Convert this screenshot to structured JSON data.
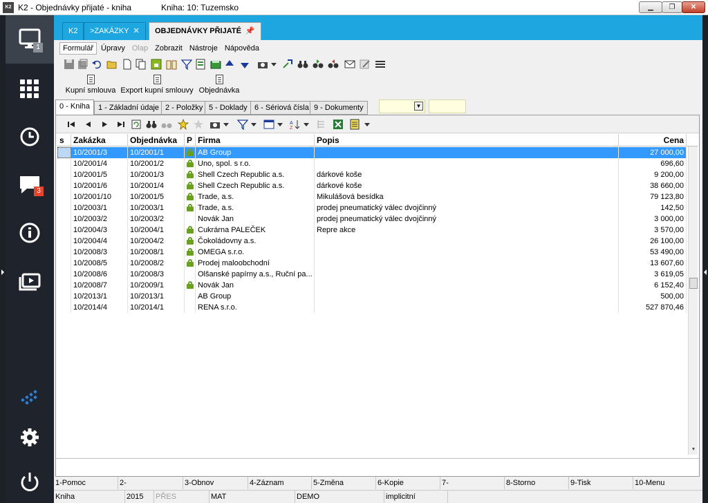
{
  "window": {
    "app_icon": "K2",
    "title": "K2 - Objednávky přijaté - kniha",
    "book": "Kniha: 10: Tuzemsko",
    "minimize": "▁",
    "restore": "❐",
    "close": "✕"
  },
  "sidenav": {
    "desktop_badge": "1",
    "messages_badge": "3",
    "icons": [
      "monitor-icon",
      "apps-grid-icon",
      "history-icon",
      "messages-icon",
      "info-icon",
      "media-icon",
      "k2-logo-icon",
      "settings-icon",
      "power-icon"
    ]
  },
  "tabs": [
    {
      "label": "K2"
    },
    {
      "label": ">ZAKÁZKY",
      "close": "✕"
    },
    {
      "label": "OBJEDNÁVKY PŘIJATÉ",
      "pin": "📌"
    }
  ],
  "menu": [
    "Formulář",
    "Úpravy",
    "Olap",
    "Zobrazit",
    "Nástroje",
    "Nápověda"
  ],
  "actions": [
    "Kupní smlouva",
    "Export kupní smlouvy",
    "Objednávka"
  ],
  "subtabs": [
    "0 - Kniha",
    "1 - Základní údaje",
    "2 - Položky",
    "5 - Doklady",
    "6 - Sériová čísla",
    "9 - Dokumenty"
  ],
  "grid": {
    "headers": {
      "s": "s",
      "zakazka": "Zakázka",
      "objednavka": "Objednávka",
      "p": "P",
      "firma": "Firma",
      "popis": "Popis",
      "cena": "Cena"
    },
    "rows": [
      {
        "zakazka": "10/2001/3",
        "objednavka": "10/2001/1",
        "locked": true,
        "firma": "AB Group",
        "popis": "",
        "cena": "27 000,00",
        "selected": true
      },
      {
        "zakazka": "10/2001/4",
        "objednavka": "10/2001/2",
        "locked": true,
        "firma": "Uno, spol. s r.o.",
        "popis": "",
        "cena": "696,60"
      },
      {
        "zakazka": "10/2001/5",
        "objednavka": "10/2001/3",
        "locked": true,
        "firma": "Shell Czech Republic a.s.",
        "popis": "dárkové koše",
        "cena": "9 200,00"
      },
      {
        "zakazka": "10/2001/6",
        "objednavka": "10/2001/4",
        "locked": true,
        "firma": "Shell Czech Republic a.s.",
        "popis": "dárkové koše",
        "cena": "38 660,00"
      },
      {
        "zakazka": "10/2001/10",
        "objednavka": "10/2001/5",
        "locked": true,
        "firma": "Trade, a.s.",
        "popis": "Mikulášová besídka",
        "cena": "79 123,80"
      },
      {
        "zakazka": "10/2003/1",
        "objednavka": "10/2003/1",
        "locked": true,
        "firma": "Trade, a.s.",
        "popis": "prodej pneumatický válec dvojčinný",
        "cena": "142,50"
      },
      {
        "zakazka": "10/2003/2",
        "objednavka": "10/2003/2",
        "locked": false,
        "firma": "Novák Jan",
        "popis": "prodej pneumatický válec dvojčinný",
        "cena": "3 000,00"
      },
      {
        "zakazka": "10/2004/3",
        "objednavka": "10/2004/1",
        "locked": true,
        "firma": "Cukrárna PALEČEK",
        "popis": "Repre akce",
        "cena": "3 570,00"
      },
      {
        "zakazka": "10/2004/4",
        "objednavka": "10/2004/2",
        "locked": true,
        "firma": "Čokoládovny a.s.",
        "popis": "",
        "cena": "26 100,00"
      },
      {
        "zakazka": "10/2008/3",
        "objednavka": "10/2008/1",
        "locked": true,
        "firma": "OMEGA s.r.o.",
        "popis": "",
        "cena": "53 490,00"
      },
      {
        "zakazka": "10/2008/5",
        "objednavka": "10/2008/2",
        "locked": true,
        "firma": "Prodej maloobchodní",
        "popis": "",
        "cena": "13 607,60"
      },
      {
        "zakazka": "10/2008/6",
        "objednavka": "10/2008/3",
        "locked": false,
        "firma": "Olšanské papírny a.s., Ruční pa...",
        "popis": "",
        "cena": "3 619,05"
      },
      {
        "zakazka": "10/2008/7",
        "objednavka": "10/2009/1",
        "locked": true,
        "firma": "Novák Jan",
        "popis": "",
        "cena": "6 152,40"
      },
      {
        "zakazka": "10/2013/1",
        "objednavka": "10/2013/1",
        "locked": false,
        "firma": "AB Group",
        "popis": "",
        "cena": "500,00"
      },
      {
        "zakazka": "10/2014/4",
        "objednavka": "10/2014/1",
        "locked": false,
        "firma": "RENA s.r.o.",
        "popis": "",
        "cena": "527 870,46"
      }
    ]
  },
  "fkeys": [
    "1-Pomoc",
    "2-",
    "3-Obnov",
    "4-Záznam",
    "5-Změna",
    "6-Kopie",
    "7-",
    "8-Storno",
    "9-Tisk",
    "10-Menu"
  ],
  "status": [
    "Kniha",
    "2015",
    "PŘES",
    "MAT",
    "DEMO",
    "implicitní"
  ],
  "colors": {
    "accent": "#1ea6e0",
    "sidebar": "#1f242c",
    "selection": "#3399ff",
    "lock": "#6aa021",
    "badge": "#e8442c"
  }
}
